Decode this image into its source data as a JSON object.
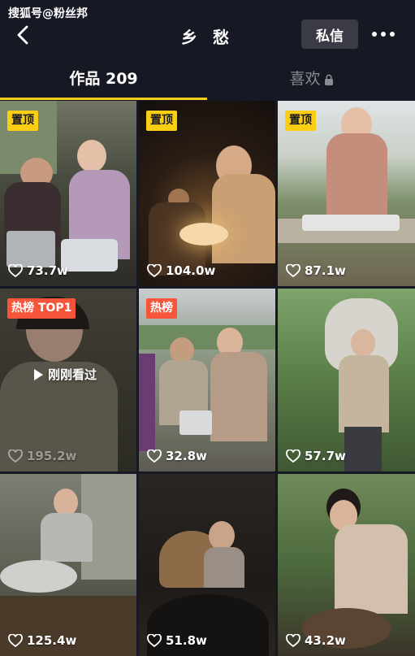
{
  "watermark": "搜狐号@粉丝邦",
  "header": {
    "title": "乡 愁",
    "message_label": "私信"
  },
  "tabs": {
    "works_label": "作品 209",
    "likes_label": "喜欢"
  },
  "colors": {
    "background": "#161823",
    "tab_underline": "#face15",
    "pin_badge": "#face15",
    "hot_badge": "#f7553a"
  },
  "videos": [
    {
      "badge": "置顶",
      "badge_type": "pin",
      "likes": "73.7w"
    },
    {
      "badge": "置顶",
      "badge_type": "pin",
      "likes": "104.0w"
    },
    {
      "badge": "置顶",
      "badge_type": "pin",
      "likes": "87.1w"
    },
    {
      "badge": "热榜 TOP1",
      "badge_type": "hot",
      "likes": "195.2w",
      "overlay": "刚刚看过"
    },
    {
      "badge": "热榜",
      "badge_type": "hot",
      "likes": "32.8w"
    },
    {
      "likes": "57.7w"
    },
    {
      "likes": "125.4w"
    },
    {
      "likes": "51.8w"
    },
    {
      "likes": "43.2w"
    }
  ]
}
